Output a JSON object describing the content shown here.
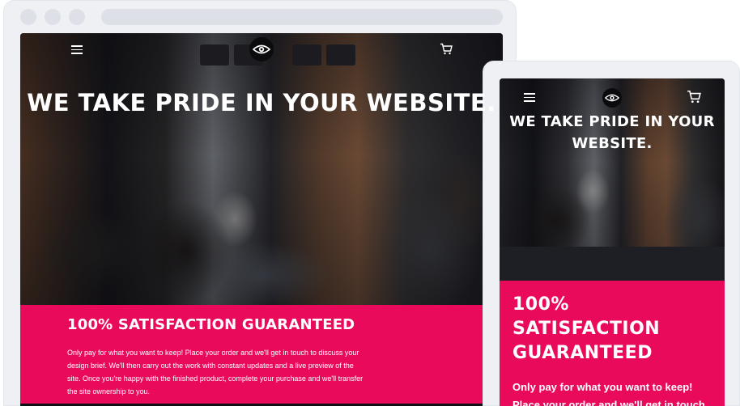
{
  "desktop": {
    "hero_title": "WE TAKE PRIDE IN YOUR WEBSITE.",
    "section_title": "100% SATISFACTION GUARANTEED",
    "section_body": "Only pay for what you want to keep! Place your order and we'll get in touch to discuss your design brief. We'll then carry out the work with constant updates and a live preview of the site. Once you're happy with the finished product, complete your purchase and we'll transfer the site ownership to you."
  },
  "mobile": {
    "hero_title": "WE TAKE PRIDE IN YOUR WEBSITE.",
    "section_title": "100% SATISFACTION GUARANTEED",
    "section_body": "Only pay for what you want to keep! Place your order and we'll get in touch"
  },
  "icons": {
    "menu": "menu-icon",
    "logo": "eye-logo-icon",
    "cart": "cart-icon"
  },
  "colors": {
    "accent_pink": "#ea0a5b",
    "frame": "#eef0f4",
    "dark_band": "#1d1f24"
  }
}
